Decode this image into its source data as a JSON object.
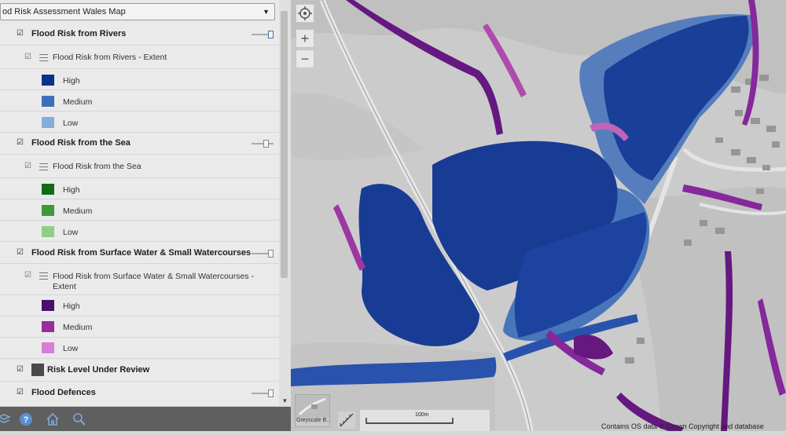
{
  "map_service": {
    "selected": "od Risk Assessment Wales Map"
  },
  "layers": {
    "rivers": {
      "title": "Flood Risk from Rivers",
      "sublayer": "Flood Risk from Rivers - Extent",
      "legend": [
        {
          "label": "High",
          "color": "#0f2f8c"
        },
        {
          "label": "Medium",
          "color": "#3f6fba"
        },
        {
          "label": "Low",
          "color": "#87acd8"
        }
      ]
    },
    "sea": {
      "title": "Flood Risk from the Sea",
      "sublayer": "Flood Risk from the Sea",
      "legend": [
        {
          "label": "High",
          "color": "#156b15"
        },
        {
          "label": "Medium",
          "color": "#3c9a3c"
        },
        {
          "label": "Low",
          "color": "#8dcf85"
        }
      ]
    },
    "surface": {
      "title": "Flood Risk from Surface Water & Small Watercourses",
      "sublayer_line1": "Flood Risk from Surface Water & Small Watercourses -",
      "sublayer_line2": "Extent",
      "legend": [
        {
          "label": "High",
          "color": "#4a0f6a"
        },
        {
          "label": "Medium",
          "color": "#9b2b9e"
        },
        {
          "label": "Low",
          "color": "#d97ed6"
        }
      ]
    },
    "review": {
      "title": "Risk Level Under Review",
      "color": "#4a4a4a"
    },
    "defences": {
      "title": "Flood Defences"
    }
  },
  "map": {
    "basemap_label": "Greyscale B...",
    "scale_label": "100m",
    "copyright": "Contains OS data © Crown Copyright and database"
  },
  "icons": {
    "locate": "crosshair-icon",
    "zoom_in": "plus-icon",
    "zoom_out": "minus-icon",
    "help": "help-icon",
    "home": "home-icon",
    "search": "magnifier-icon",
    "measure": "measure-icon"
  }
}
